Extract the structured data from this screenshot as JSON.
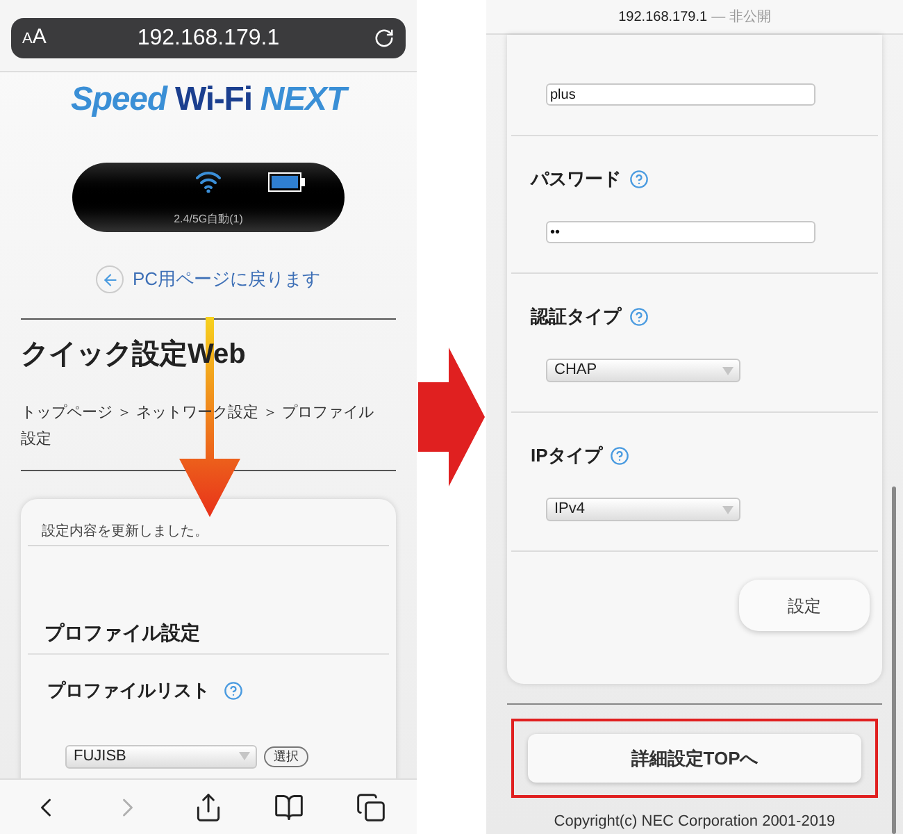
{
  "left_screen": {
    "address_bar": {
      "text_size_button": "AA",
      "url": "192.168.179.1"
    },
    "logo": {
      "part_1": "Speed",
      "part_2": "Wi-Fi",
      "part_3": "NEXT"
    },
    "device_status": "2.4/5G自動(1)",
    "back_link": "PC用ページに戻ります",
    "title": "クイック設定Web",
    "breadcrumb": "トップページ ＞ ネットワーク設定 ＞ プロファイル設定",
    "message": "設定内容を更新しました。",
    "section_title": "プロファイル設定",
    "profile_list": {
      "label": "プロファイルリスト",
      "value": "FUJISB",
      "button": "選択"
    },
    "toolbar": [
      {
        "kind": "back",
        "disabled": false
      },
      {
        "kind": "forward",
        "disabled": true
      },
      {
        "kind": "share",
        "disabled": false
      },
      {
        "kind": "bookmarks",
        "disabled": false
      },
      {
        "kind": "tabs",
        "disabled": false
      }
    ]
  },
  "right_screen": {
    "address_bar": {
      "url": "192.168.179.1",
      "privacy": "— 非公開"
    },
    "fields": [
      {
        "kind": "input",
        "value": "plus"
      },
      {
        "kind": "password",
        "label": "パスワード",
        "value": "••"
      },
      {
        "kind": "select",
        "label": "認証タイプ",
        "value": "CHAP"
      },
      {
        "kind": "select",
        "label": "IPタイプ",
        "value": "IPv4"
      }
    ],
    "submit_button": "設定",
    "top_button": {
      "label": "詳細設定TOPへ",
      "highlighted": true
    },
    "copyright": "Copyright(c) NEC Corporation 2001-2019"
  }
}
